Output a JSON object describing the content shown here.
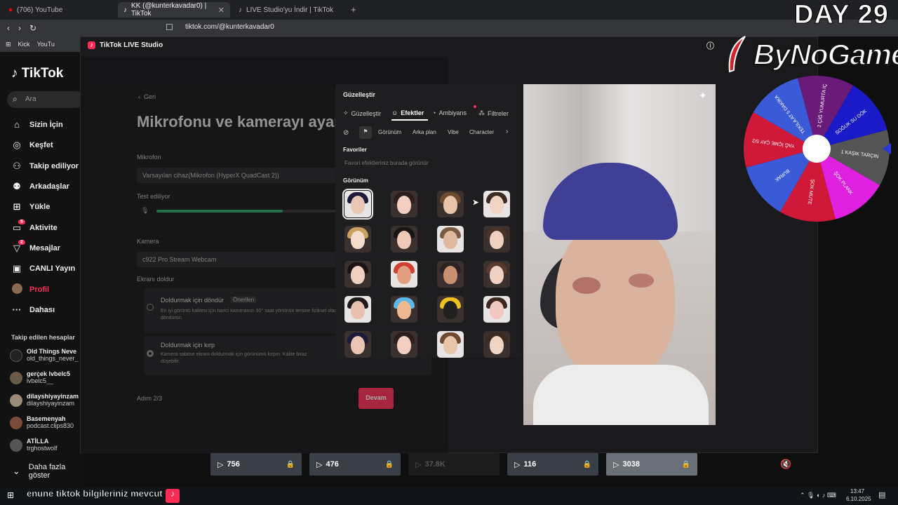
{
  "browser": {
    "tabs": [
      {
        "label": "(706) YouTube"
      },
      {
        "label": "KK (@kunterkavadar0) | TikTok"
      },
      {
        "label": "LIVE Studio'yu İndir | TikTok"
      }
    ],
    "url": "tiktok.com/@kunterkavadar0",
    "bookmarks": [
      "Kick",
      "YouTu"
    ]
  },
  "sidebar": {
    "logo": "TikTok",
    "search_placeholder": "Ara",
    "nav": [
      {
        "label": "Sizin İçin",
        "icon": "home-icon"
      },
      {
        "label": "Keşfet",
        "icon": "compass-icon"
      },
      {
        "label": "Takip ediliyor",
        "icon": "following-icon"
      },
      {
        "label": "Arkadaşlar",
        "icon": "friends-icon"
      },
      {
        "label": "Yükle",
        "icon": "upload-icon"
      },
      {
        "label": "Aktivite",
        "icon": "activity-icon",
        "badge": "5"
      },
      {
        "label": "Mesajlar",
        "icon": "messages-icon",
        "badge": "2"
      },
      {
        "label": "CANLI Yayın",
        "icon": "live-icon"
      },
      {
        "label": "Profil",
        "icon": "avatar-icon"
      },
      {
        "label": "Dahası",
        "icon": "more-icon"
      }
    ],
    "following_title": "Takip edilen hesaplar",
    "following": [
      {
        "name": "Old Things Neve",
        "handle": "old_things_never_"
      },
      {
        "name": "gerçek lvbelc5",
        "handle": "lvbelc5__"
      },
      {
        "name": "dilayshiyayinzam",
        "handle": "dilayshiyayinzam"
      },
      {
        "name": "Basemenyah",
        "handle": "podcast.clips830"
      },
      {
        "name": "ATİLLA",
        "handle": "trghostwolf"
      }
    ],
    "show_more": "Daha fazla göster"
  },
  "studio": {
    "title": "TikTok LIVE Studio",
    "back": "Geri",
    "heading": "Mikrofonu ve kamerayı ayarla",
    "mic_label": "Mikrofon",
    "mic_value": "Varsayılan cihaz(Mikrofon (HyperX QuadCast 2))",
    "test_label": "Test ediliyor",
    "mic_level": 0.6,
    "camera_label": "Kamera",
    "camera_value": "c922 Pro Stream Webcam",
    "fill_label": "Ekranı doldur",
    "option1_title": "Doldurmak için döndür",
    "option1_tag": "Önerilen",
    "option1_desc": "En iyi görüntü kalitesi için harici kameranızı 90° saat yönünün tersine fiziksel olarak döndürün.",
    "option2_title": "Doldurmak için kırp",
    "option2_desc": "Kamera sabitse ekranı doldurmak için görünümü kırpın. Kalite biraz düşebilir.",
    "step": "Adım 2/3",
    "continue": "Devam"
  },
  "effects": {
    "title": "Güzelleştir",
    "tabs": [
      "Güzelleştir",
      "Efektler",
      "Ambiyans",
      "Filtreler"
    ],
    "active_tab": "Efektler",
    "chips": [
      "Görünüm",
      "Arka plan",
      "Vibe",
      "Character"
    ],
    "favorites_title": "Favoriler",
    "favorites_empty": "Favori efektleriniz burada görünür",
    "section_title": "Görünüm"
  },
  "overlay": {
    "day": "DAY 29",
    "brand": "ByNoGame",
    "wheel": [
      "SOĞUK SU DÖK",
      "1 KAŞIK TARÇIN",
      "ŞOK PLANK",
      "ŞOK MUTE",
      "BURAK",
      "YAĞ İÇME ÇAY 5/2",
      "TEKİLA AT 5 DAKİKA",
      "2 ÇİĞ YUMURTA İÇ"
    ]
  },
  "thumbnails": [
    {
      "views": "756"
    },
    {
      "views": "476"
    },
    {
      "views": "37.8K"
    },
    {
      "views": "116"
    },
    {
      "views": "3038"
    }
  ],
  "taskbar": {
    "marquee": "enune tiktok bilgileriniz mevcut",
    "time": "13:47",
    "date": "6.10.2025"
  }
}
